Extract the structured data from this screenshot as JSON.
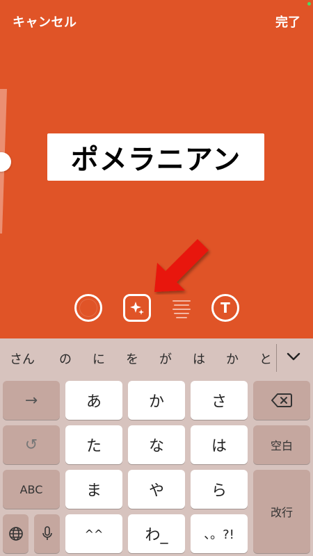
{
  "topbar": {
    "cancel_label": "キャンセル",
    "done_label": "完了"
  },
  "canvas": {
    "background_color": "#e05427",
    "sticker_text": "ポメラニアン"
  },
  "tools": [
    {
      "name": "color",
      "icon": "color-circle-icon"
    },
    {
      "name": "effect",
      "icon": "sparkle-icon"
    },
    {
      "name": "align",
      "icon": "align-lines-icon"
    },
    {
      "name": "font",
      "icon": "text-t-icon",
      "label": "T"
    }
  ],
  "keyboard": {
    "candidates": [
      "さん",
      "の",
      "に",
      "を",
      "が",
      "は",
      "か",
      "と"
    ],
    "rows": [
      [
        "→",
        "あ",
        "か",
        "さ",
        "⌫"
      ],
      [
        "↺",
        "た",
        "な",
        "は",
        "空白"
      ],
      [
        "ABC",
        "ま",
        "や",
        "ら",
        "改行"
      ],
      [
        "🌐",
        "🎤",
        "^^",
        "わ_",
        "、。?!"
      ]
    ],
    "keys": {
      "next": "→",
      "a": "あ",
      "ka": "か",
      "sa": "さ",
      "undo": "↺",
      "ta": "た",
      "na": "な",
      "ha": "は",
      "space": "空白",
      "abc": "ABC",
      "ma": "ま",
      "ya": "や",
      "ra": "ら",
      "return": "改行",
      "kaomoji": "^^",
      "wa": "わ_",
      "punct": "、。?!"
    }
  },
  "accent": {
    "arrow_color": "#e8120c",
    "keyboard_bg": "#d7c3be"
  }
}
